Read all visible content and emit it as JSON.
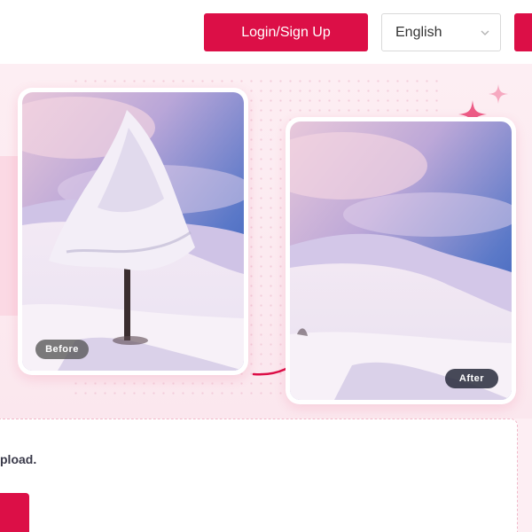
{
  "header": {
    "login_label": "Login/Sign Up",
    "language": {
      "selected": "English"
    }
  },
  "hero": {
    "before_label": "Before",
    "after_label": "After"
  },
  "upload": {
    "text": "pload."
  },
  "colors": {
    "accent": "#dc0f47",
    "background": "#fdeef3"
  },
  "icons": [
    "chevron-down-icon",
    "sparkle-icon",
    "curved-arrow-icon"
  ]
}
